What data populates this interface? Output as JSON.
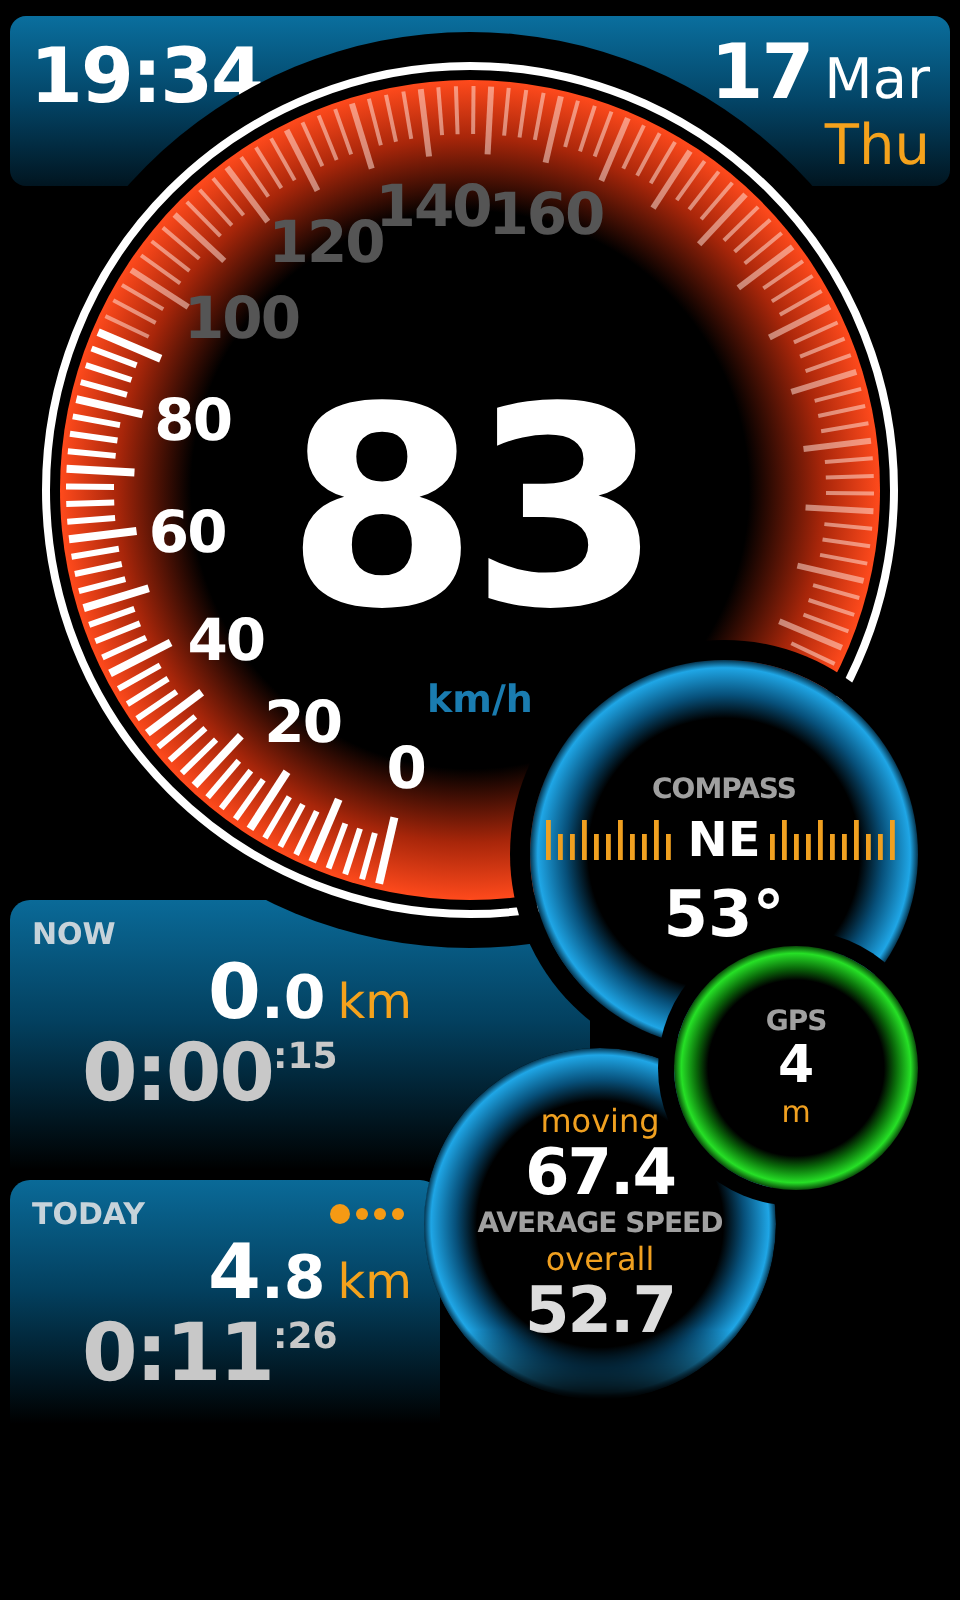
{
  "header": {
    "time": "19:34",
    "day": "17",
    "month": "Mar",
    "weekday": "Thu"
  },
  "speedometer": {
    "speed": "83",
    "unit": "km/h",
    "scale": [
      {
        "label": "0",
        "lit": true
      },
      {
        "label": "20",
        "lit": true
      },
      {
        "label": "40",
        "lit": true
      },
      {
        "label": "60",
        "lit": true
      },
      {
        "label": "80",
        "lit": true
      },
      {
        "label": "100",
        "lit": false
      },
      {
        "label": "120",
        "lit": false
      },
      {
        "label": "140",
        "lit": false
      },
      {
        "label": "160",
        "lit": false
      }
    ]
  },
  "compass": {
    "title": "COMPASS",
    "heading": "NE",
    "degrees": "53°"
  },
  "gps": {
    "title": "GPS",
    "accuracy": "4",
    "unit": "m"
  },
  "average_speed": {
    "moving_label": "moving",
    "moving": "67.4",
    "title": "AVERAGE SPEED",
    "overall_label": "overall",
    "overall": "52.7"
  },
  "trips": [
    {
      "title": "NOW",
      "distance_int": "0",
      "distance_frac": ".0",
      "unit": "km",
      "time": "0:00",
      "seconds": ":15"
    },
    {
      "title": "TODAY",
      "distance_int": "4",
      "distance_frac": ".8",
      "unit": "km",
      "time": "0:11",
      "seconds": ":26",
      "pages": [
        {
          "selected": true
        },
        {
          "selected": false
        },
        {
          "selected": false
        },
        {
          "selected": false
        }
      ]
    }
  ]
}
